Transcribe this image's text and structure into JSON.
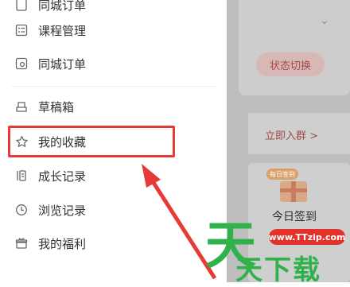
{
  "background": {
    "status_button": "状态切换",
    "join_group": "立即入群 >",
    "checkin_badge": "每日签到",
    "checkin_label": "今日签到"
  },
  "drawer": {
    "items": [
      {
        "label": "同城订单",
        "icon": "doc-icon",
        "partial": true
      },
      {
        "label": "课程管理",
        "icon": "list-icon"
      },
      {
        "label": "同城订单",
        "icon": "order-icon"
      },
      {
        "label": "草稿箱",
        "icon": "draft-icon"
      },
      {
        "label": "我的收藏",
        "icon": "star-icon"
      },
      {
        "label": "成长记录",
        "icon": "growth-icon"
      },
      {
        "label": "浏览记录",
        "icon": "clock-icon"
      },
      {
        "label": "我的福利",
        "icon": "gift-icon"
      }
    ]
  },
  "watermark": {
    "url": "www.TTzip.com",
    "big_char": "天",
    "text": "天下载"
  },
  "annotation": {
    "highlight_color": "#e53a35"
  }
}
